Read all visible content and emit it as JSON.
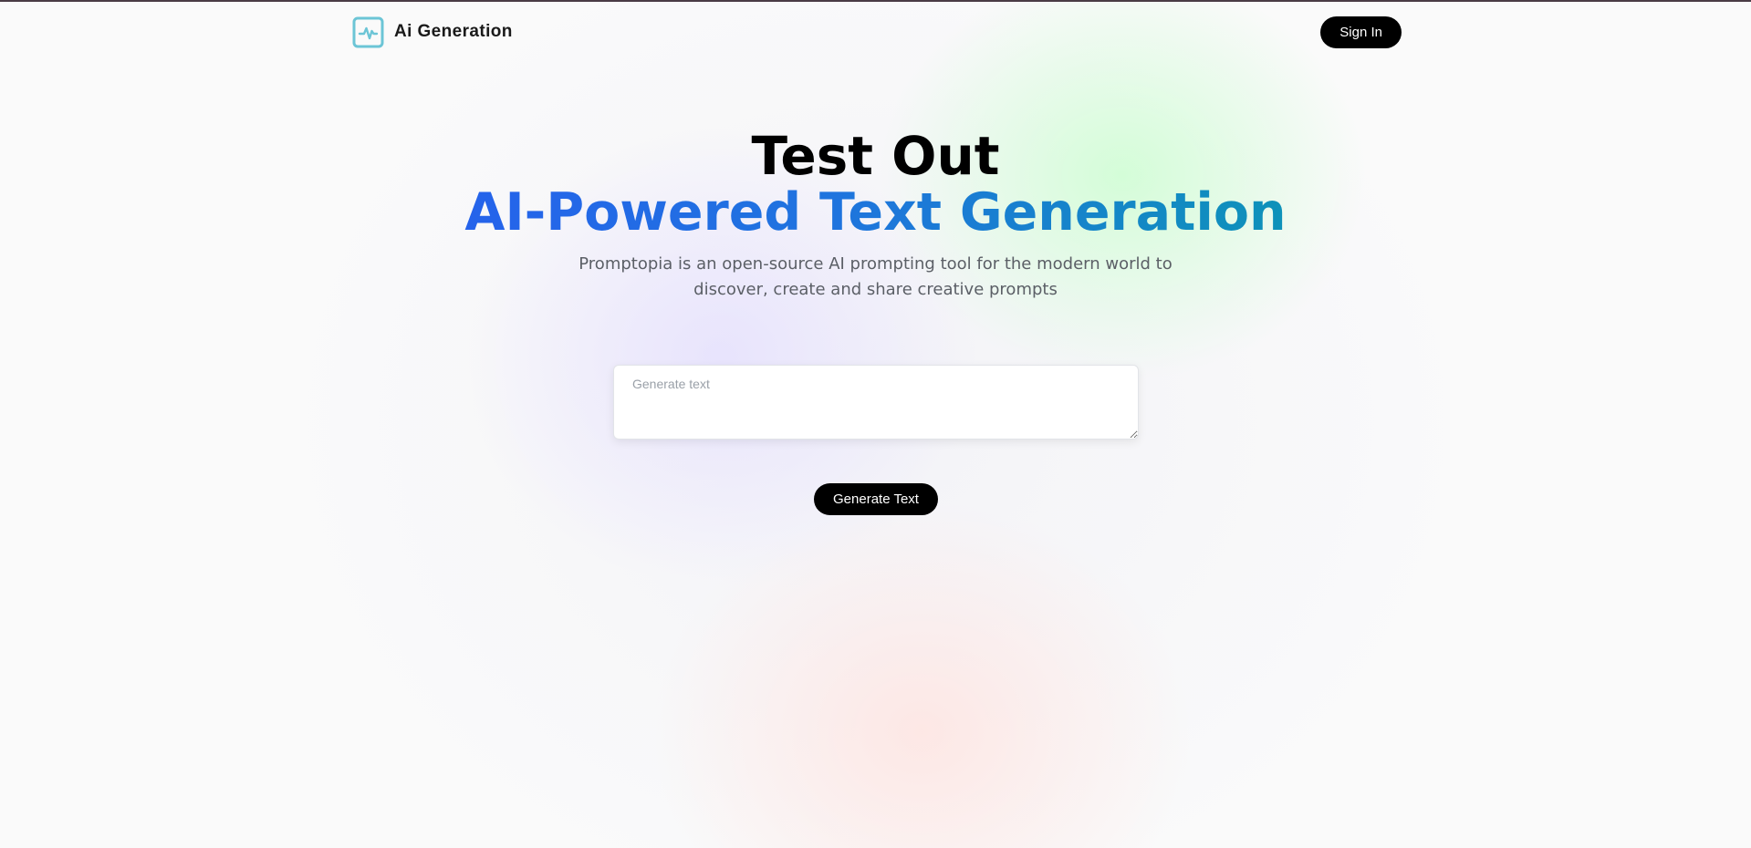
{
  "nav": {
    "brand_name": "Ai Generation",
    "logo_icon": "activity-pulse-icon",
    "signin_label": "Sign In"
  },
  "hero": {
    "title_line1": "Test Out",
    "title_line2": "AI-Powered Text Generation",
    "subtitle": "Promptopia is an open-source AI prompting tool for the modern world to discover, create and share creative prompts"
  },
  "form": {
    "prompt_placeholder": "Generate text",
    "prompt_value": "",
    "submit_label": "Generate Text"
  },
  "colors": {
    "accent_blue": "#2563eb",
    "accent_cyan": "#0e92b9",
    "logo_teal": "#6cc5d6",
    "button_bg": "#000000"
  }
}
